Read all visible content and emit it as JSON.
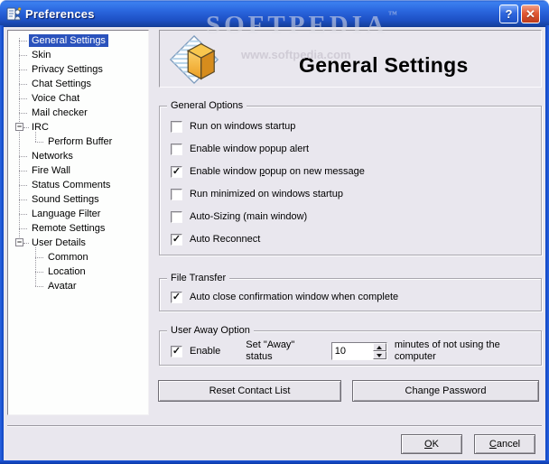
{
  "window": {
    "title": "Preferences"
  },
  "icons": {
    "checkmark": "✓",
    "collapse": "−",
    "help": "?",
    "close": "✕"
  },
  "watermark": {
    "brand": "SOFTPEDIA",
    "tm": "™",
    "url": "www.softpedia.com"
  },
  "tree": {
    "items": [
      {
        "label": "General Settings",
        "level": 0,
        "selected": true
      },
      {
        "label": "Skin",
        "level": 0
      },
      {
        "label": "Privacy Settings",
        "level": 0
      },
      {
        "label": "Chat Settings",
        "level": 0
      },
      {
        "label": "Voice Chat",
        "level": 0
      },
      {
        "label": "Mail checker",
        "level": 0
      },
      {
        "label": "IRC",
        "level": 0,
        "expander": true
      },
      {
        "label": "Perform Buffer",
        "level": 1
      },
      {
        "label": "Networks",
        "level": 0
      },
      {
        "label": "Fire Wall",
        "level": 0
      },
      {
        "label": "Status Comments",
        "level": 0
      },
      {
        "label": "Sound Settings",
        "level": 0
      },
      {
        "label": "Language Filter",
        "level": 0
      },
      {
        "label": "Remote Settings",
        "level": 0
      },
      {
        "label": "User Details",
        "level": 0,
        "expander": true
      },
      {
        "label": "Common",
        "level": 1
      },
      {
        "label": "Location",
        "level": 1
      },
      {
        "label": "Avatar",
        "level": 1
      }
    ]
  },
  "header": {
    "title": "General Settings"
  },
  "groups": {
    "general_options": {
      "legend": "General Options",
      "items": [
        {
          "label": "Run on windows startup",
          "checked": false
        },
        {
          "label": "Enable window popup alert",
          "checked": false
        },
        {
          "label": "Enable window popup on new message",
          "checked": true,
          "accel": "p"
        },
        {
          "label": "Run minimized on windows startup",
          "checked": false
        },
        {
          "label": "Auto-Sizing (main window)",
          "checked": false
        },
        {
          "label": "Auto Reconnect",
          "checked": true
        }
      ]
    },
    "file_transfer": {
      "legend": "File Transfer",
      "items": [
        {
          "label": "Auto close confirmation window when complete",
          "checked": true
        }
      ]
    },
    "user_away": {
      "legend": "User Away Option",
      "enable_label": "Enable",
      "enable_checked": true,
      "set_label": "Set \"Away\" status",
      "value": "10",
      "suffix": "minutes of not using the computer"
    }
  },
  "actions": {
    "reset": "Reset Contact List",
    "change_password": "Change Password"
  },
  "footer": {
    "ok": {
      "label": "OK",
      "accel": "O"
    },
    "cancel": {
      "label": "Cancel",
      "accel": "C"
    }
  }
}
